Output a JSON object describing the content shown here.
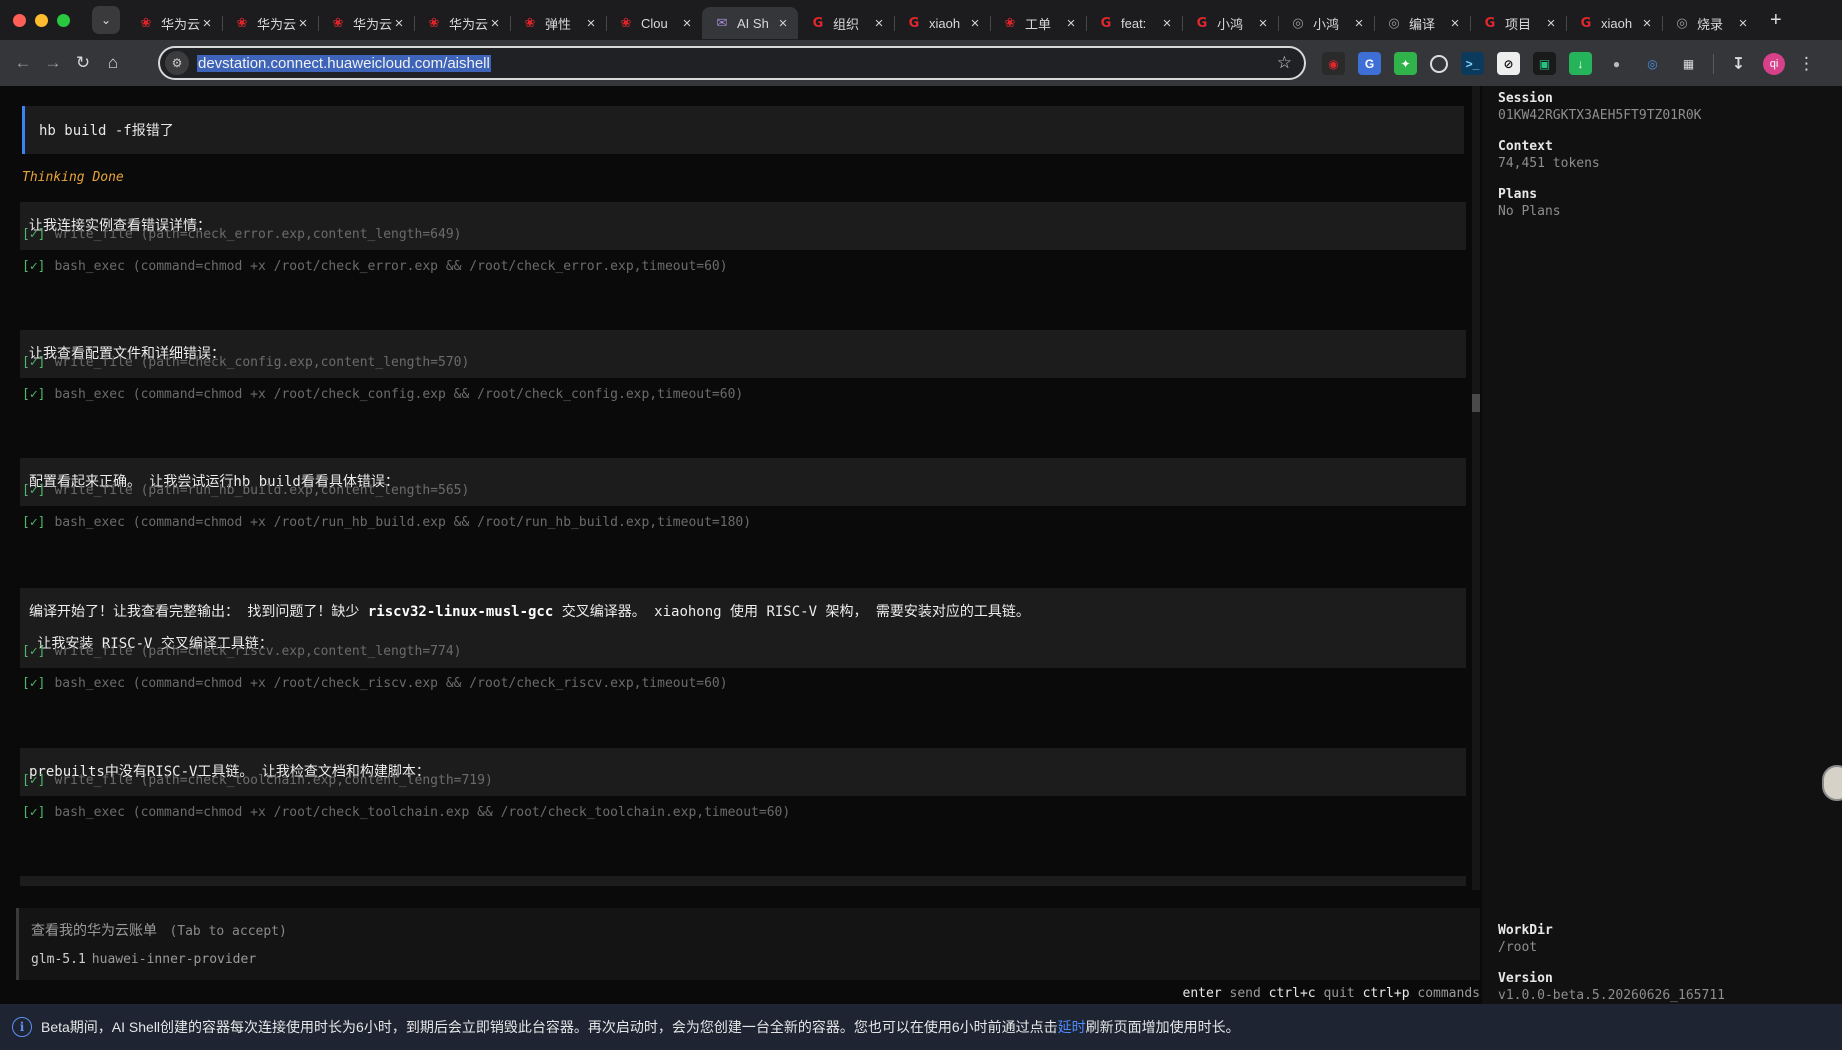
{
  "browser": {
    "tabs": [
      {
        "icon": "huawei-icon",
        "title": "华为云"
      },
      {
        "icon": "huawei-icon",
        "title": "华为云"
      },
      {
        "icon": "huawei-icon",
        "title": "华为云"
      },
      {
        "icon": "huawei-icon",
        "title": "华为云"
      },
      {
        "icon": "huawei-icon",
        "title": "弹性"
      },
      {
        "icon": "huawei-icon",
        "title": "Clou"
      },
      {
        "icon": "ai-shell-icon",
        "title": "AI Sh",
        "active": true
      },
      {
        "icon": "g-icon",
        "title": "组织"
      },
      {
        "icon": "g-icon",
        "title": "xiaoh"
      },
      {
        "icon": "huawei-icon",
        "title": "工单"
      },
      {
        "icon": "g-icon",
        "title": "feat:"
      },
      {
        "icon": "g-icon",
        "title": "小鸿"
      },
      {
        "icon": "globe-icon",
        "title": "小鸿"
      },
      {
        "icon": "globe-icon",
        "title": "编译"
      },
      {
        "icon": "g-icon",
        "title": "项目"
      },
      {
        "icon": "g-icon",
        "title": "xiaoh"
      },
      {
        "icon": "globe-icon",
        "title": "烧录"
      }
    ],
    "url": "devstation.connect.huaweicloud.com/aishell",
    "avatar_initials": "qi"
  },
  "chat": {
    "user_message": "hb build -f报错了",
    "thinking_status": "Thinking Done",
    "messages": [
      {
        "text": "让我连接实例查看错误详情："
      },
      {
        "text": "让我查看配置文件和详细错误："
      },
      {
        "text": "配置看起来正确。 让我尝试运行hb build看看具体错误："
      },
      {
        "line1_pre": "编译开始了！让我查看完整输出： 找到问题了！缺少 ",
        "line1_bold": "riscv32-linux-musl-gcc",
        "line1_post": " 交叉编译器。 xiaohong 使用 RISC-V 架构， 需要安装对应的工具链。",
        "line2": " 让我安装 RISC-V 交叉编译工具链："
      },
      {
        "text": "prebuilts中没有RISC-V工具链。 让我检查文档和构建脚本："
      }
    ],
    "tool_check": "[✓]",
    "tool_calls": [
      "write_file (path=check_error.exp,content_length=649)",
      "bash_exec (command=chmod +x /root/check_error.exp && /root/check_error.exp,timeout=60)",
      "write_file (path=check_config.exp,content_length=570)",
      "bash_exec (command=chmod +x /root/check_config.exp && /root/check_config.exp,timeout=60)",
      "write_file (path=run_hb_build.exp,content_length=565)",
      "bash_exec (command=chmod +x /root/run_hb_build.exp && /root/run_hb_build.exp,timeout=180)",
      "write_file (path=check_riscv.exp,content_length=774)",
      "bash_exec (command=chmod +x /root/check_riscv.exp && /root/check_riscv.exp,timeout=60)",
      "write_file (path=check_toolchain.exp,content_length=719)",
      "bash_exec (command=chmod +x /root/check_toolchain.exp && /root/check_toolchain.exp,timeout=60)"
    ]
  },
  "input": {
    "suggestion": "查看我的华为云账单",
    "suggestion_hint": "(Tab to accept)",
    "model": "glm-5.1",
    "provider": "huawei-inner-provider"
  },
  "keyhelp": {
    "enter": "enter",
    "send": "send",
    "ctrl_c": "ctrl+c",
    "quit": "quit",
    "ctrl_p": "ctrl+p",
    "commands": "commands"
  },
  "sidebar": {
    "session_label": "Session",
    "session_value": "01KW42RGKTX3AEH5FT9TZ01R0K",
    "context_label": "Context",
    "context_value": "74,451 tokens",
    "plans_label": "Plans",
    "plans_value": "No Plans",
    "workdir_label": "WorkDir",
    "workdir_value": "/root",
    "version_label": "Version",
    "version_value": "v1.0.0-beta.5.20260626_165711"
  },
  "banner": {
    "text_before": "Beta期间，AI Shell创建的容器每次连接使用时长为6小时，到期后会立即销毁此台容器。再次启动时，会为您创建一台全新的容器。您也可以在使用6小时前通过点击",
    "link_text": "延时",
    "text_after": "刷新页面增加使用时长。"
  },
  "colors": {
    "accent_blue": "#3b82f6",
    "check_green": "#4fb86a",
    "thinking_orange": "#e8a33a",
    "link_blue": "#4d8bff"
  }
}
